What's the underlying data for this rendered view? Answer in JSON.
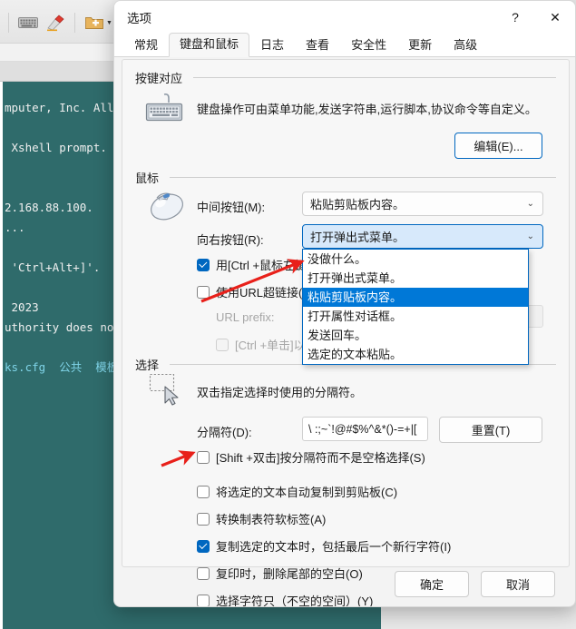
{
  "background": {
    "app_name": "xshell-window",
    "toolbar": [
      {
        "icon": "keyboard-icon",
        "label": ""
      },
      {
        "icon": "highlighter-pen-icon",
        "label": ""
      },
      {
        "icon": "new-folder-icon",
        "label": ""
      },
      {
        "icon": "layout-icon",
        "label": ""
      }
    ],
    "terminal_lines": [
      {
        "text": "mputer, Inc. All ri",
        "color": "normal"
      },
      {
        "text": "",
        "color": "normal"
      },
      {
        "text": " Xshell prompt.",
        "color": "normal"
      },
      {
        "text": "",
        "color": "normal"
      },
      {
        "text": "",
        "color": "normal"
      },
      {
        "text": "2.168.88.100.",
        "color": "normal"
      },
      {
        "text": "...",
        "color": "normal"
      },
      {
        "text": "",
        "color": "normal"
      },
      {
        "text": " 'Ctrl+Alt+]'.",
        "color": "normal"
      },
      {
        "text": "",
        "color": "normal"
      },
      {
        "text": " 2023",
        "color": "normal"
      },
      {
        "text": "uthority does not e",
        "color": "normal"
      },
      {
        "text": "",
        "color": "normal"
      },
      {
        "text": "ks.cfg  公共  模板",
        "color": "cyan"
      }
    ]
  },
  "dialog": {
    "title": "选项",
    "help_button": "?",
    "close_button": "✕",
    "tabs": [
      {
        "label": "常规",
        "active": false
      },
      {
        "label": "键盘和鼠标",
        "active": true
      },
      {
        "label": "日志",
        "active": false
      },
      {
        "label": "查看",
        "active": false
      },
      {
        "label": "安全性",
        "active": false
      },
      {
        "label": "更新",
        "active": false
      },
      {
        "label": "高级",
        "active": false
      }
    ],
    "key_mapping": {
      "group_title": "按键对应",
      "icon": "keyboard-icon",
      "description": "键盘操作可由菜单功能,发送字符串,运行脚本,协议命令等自定义。",
      "edit_button": "编辑(E)..."
    },
    "mouse": {
      "group_title": "鼠标",
      "icon": "mouse-icon",
      "middle_button_label": "中间按钮(M):",
      "middle_button_value": "粘贴剪贴板内容。",
      "right_button_label": "向右按钮(R):",
      "right_button_value": "打开弹出式菜单。",
      "dropdown_options": [
        "没做什么。",
        "打开弹出式菜单。",
        "粘贴剪贴板内容。",
        "打开属性对话框。",
        "发送回车。",
        "选定的文本粘贴。"
      ],
      "dropdown_selected_index": 2,
      "ctrl_left_click_label": "用[Ctrl +鼠标左键",
      "ctrl_left_click_checked": true,
      "url_hyperlink_label": "使用URL超链接(H)",
      "url_hyperlink_checked": false,
      "url_prefix_label": "URL prefix:",
      "url_prefix_value": "",
      "ctrl_click_open_label": "[Ctrl +单击]以打"
    },
    "selection": {
      "group_title": "选择",
      "icon": "selection-rectangle-icon",
      "description": "双击指定选择时使用的分隔符。",
      "delimiter_label": "分隔符(D):",
      "delimiter_value": "\\ :;~`!@#$%^&*()-=+|[",
      "reset_button": "重置(T)",
      "checkboxes": [
        {
          "label": "[Shift +双击]按分隔符而不是空格选择(S)",
          "checked": false
        },
        {
          "label": "将选定的文本自动复制到剪贴板(C)",
          "checked": false
        },
        {
          "label": "转换制表符软标签(A)",
          "checked": false
        },
        {
          "label": "复制选定的文本时，包括最后一个新行字符(I)",
          "checked": true
        },
        {
          "label": "复印时，删除尾部的空白(O)",
          "checked": false
        },
        {
          "label": "选择字符只（不空的空间）(Y)",
          "checked": false
        }
      ]
    },
    "footer": {
      "ok_button": "确定",
      "cancel_button": "取消"
    }
  },
  "annotations": {
    "arrow_color": "#e8201a",
    "arrow_1_target": "dropdown-selected-option",
    "arrow_2_target": "auto-copy-checkbox"
  },
  "colors": {
    "accent": "#0067c0",
    "highlight": "#0078d7",
    "terminal_bg": "#2f6b6b",
    "terminal_cyan": "#7fd4e8"
  }
}
